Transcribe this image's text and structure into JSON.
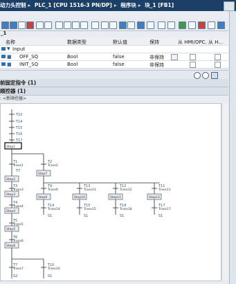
{
  "breadcrumb": [
    "动力头控制",
    "PLC_1 [CPU 1516-3 PN/DP]",
    "程序块",
    "块_1 [FB1]"
  ],
  "interface": {
    "header_label": "_1",
    "columns": [
      "名称",
      "数据类型",
      "默认值",
      "保持",
      "从 HMI/OPC...",
      "从 H..."
    ],
    "rows": [
      {
        "name": "Input",
        "type": "",
        "default": "",
        "retain": ""
      },
      {
        "name": "OFF_SQ",
        "type": "Bool",
        "default": "false",
        "retain": "非保持"
      },
      {
        "name": "INIT_SQ",
        "type": "Bool",
        "default": "false",
        "retain": "非保持"
      }
    ]
  },
  "sections": {
    "fixed": "前固定指令 (1)",
    "sequencer": "顺控器 (1)",
    "sub": ": <新顺控器>"
  },
  "graph": {
    "top_transitions": [
      "T10",
      "T14",
      "T15",
      "T16",
      "T17"
    ],
    "steps": [
      "Step1",
      "Step2",
      "Step3",
      "Step4",
      "Step5",
      "Step6",
      "Step7",
      "Step8",
      "Step9",
      "Step10",
      "Step11",
      "Step12"
    ],
    "transitions": [
      {
        "id": "T1",
        "name": "Trans1"
      },
      {
        "id": "T2",
        "name": "Trans2"
      },
      {
        "id": "T3",
        "name": "Trans3"
      },
      {
        "id": "T4",
        "name": "Trans4"
      },
      {
        "id": "T5",
        "name": "Trans5"
      },
      {
        "id": "T6",
        "name": "Trans6"
      },
      {
        "id": "T7",
        "name": "Trans7"
      },
      {
        "id": "T9",
        "name": "Trans9"
      },
      {
        "id": "T10",
        "name": "Trans10"
      },
      {
        "id": "T11",
        "name": "Trans11"
      },
      {
        "id": "T12",
        "name": "Trans12"
      },
      {
        "id": "T13",
        "name": "Trans13"
      },
      {
        "id": "T14",
        "name": "Trans14"
      },
      {
        "id": "T15",
        "name": "Trans15"
      },
      {
        "id": "T16",
        "name": "Trans16"
      },
      {
        "id": "T17",
        "name": "Trans17"
      },
      {
        "id": "T18",
        "name": "Trans18"
      }
    ],
    "jumps": [
      "T7",
      "S1",
      "S1",
      "S1",
      "S1",
      "S2",
      "S1"
    ]
  }
}
